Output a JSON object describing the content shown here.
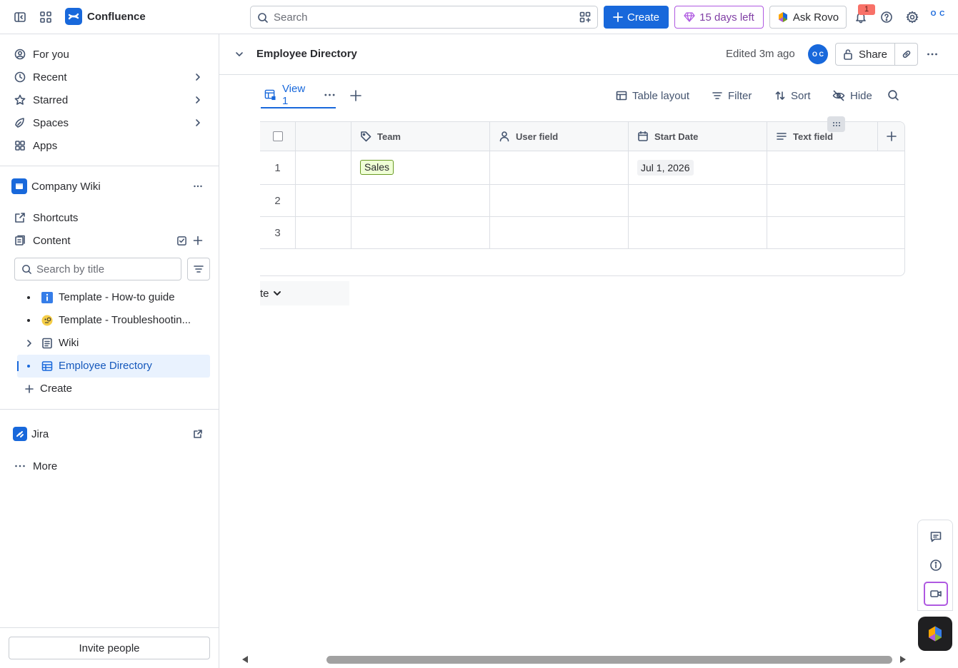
{
  "topbar": {
    "app_name": "Confluence",
    "search_placeholder": "Search",
    "create_label": "Create",
    "trial_label": "15 days left",
    "rovo_label": "Ask Rovo",
    "notification_count": "1",
    "org_avatar": "O C"
  },
  "sidebar": {
    "nav": [
      {
        "label": "For you",
        "icon": "user-circle-icon"
      },
      {
        "label": "Recent",
        "icon": "clock-icon"
      },
      {
        "label": "Starred",
        "icon": "star-icon"
      },
      {
        "label": "Spaces",
        "icon": "spaces-icon"
      },
      {
        "label": "Apps",
        "icon": "apps-icon"
      }
    ],
    "space_name": "Company Wiki",
    "shortcuts_label": "Shortcuts",
    "content_label": "Content",
    "search_placeholder": "Search by title",
    "tree": [
      {
        "label": "Template - How-to guide",
        "icon": "info-icon"
      },
      {
        "label": "Template - Troubleshootin...",
        "icon": "face-monocle-icon"
      },
      {
        "label": "Wiki",
        "icon": "page-icon"
      },
      {
        "label": "Employee Directory",
        "icon": "database-icon"
      }
    ],
    "create_label": "Create",
    "jira_label": "Jira",
    "more_label": "More",
    "invite_label": "Invite people"
  },
  "page": {
    "title": "Employee Directory",
    "edited": "Edited 3m ago",
    "avatar": "O C",
    "share_label": "Share"
  },
  "viewbar": {
    "tab_label": "View 1",
    "table_layout": "Table layout",
    "filter": "Filter",
    "sort": "Sort",
    "hide": "Hide"
  },
  "table": {
    "columns": [
      {
        "label": "Team",
        "icon": "tag-icon"
      },
      {
        "label": "User field",
        "icon": "person-icon"
      },
      {
        "label": "Start Date",
        "icon": "calendar-icon"
      },
      {
        "label": "Text field",
        "icon": "text-lines-icon"
      }
    ],
    "rows": [
      {
        "num": "1",
        "team": "Sales",
        "user": "",
        "start": "Jul 1, 2026",
        "text": ""
      },
      {
        "num": "2",
        "team": "",
        "user": "",
        "start": "",
        "text": ""
      },
      {
        "num": "3",
        "team": "",
        "user": "",
        "start": "",
        "text": ""
      }
    ]
  },
  "sort_chip_label": "te",
  "colors": {
    "accent": "#1868DB",
    "trial": "#803FA5",
    "lozenge_green": "#EFFFD6",
    "active_bg": "#E9F2FE"
  }
}
